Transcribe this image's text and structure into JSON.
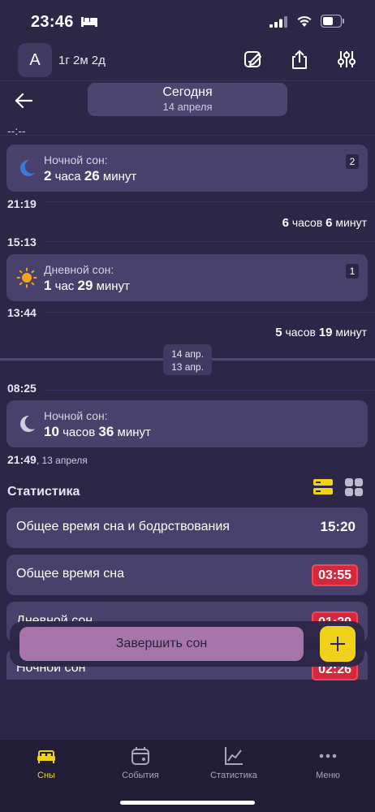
{
  "status_bar": {
    "time": "23:46"
  },
  "header": {
    "avatar_letter": "A",
    "age": "1г 2м 2д"
  },
  "date_nav": {
    "title": "Сегодня",
    "subtitle": "14 апреля"
  },
  "timeline": {
    "top_time": "--:--",
    "entries": [
      {
        "label": "Ночной сон:",
        "d1": "2",
        "u1": "часа",
        "d2": "26",
        "u2": "минут",
        "count": "2",
        "kind": "night"
      },
      {
        "label": "Дневной сон:",
        "d1": "1",
        "u1": "час",
        "d2": "29",
        "u2": "минут",
        "count": "1",
        "kind": "day"
      },
      {
        "label": "Ночной сон:",
        "d1": "10",
        "u1": "часов",
        "d2": "36",
        "u2": "минут",
        "kind": "night"
      }
    ],
    "times": [
      "21:19",
      "15:13",
      "13:44",
      "08:25",
      "21:49"
    ],
    "last_time_date": ", 13 апреля",
    "awake": [
      {
        "d1": "6",
        "u1": "часов",
        "d2": "6",
        "u2": "минут"
      },
      {
        "d1": "5",
        "u1": "часов",
        "d2": "19",
        "u2": "минут"
      }
    ],
    "day_badge": {
      "top": "14 апр.",
      "bottom": "13 апр."
    }
  },
  "stats": {
    "title": "Статистика",
    "rows": [
      {
        "label": "Общее время сна и бодрствования",
        "value": "15:20",
        "alert": false
      },
      {
        "label": "Общее время сна",
        "value": "03:55",
        "alert": true
      },
      {
        "label": "Дневной сон",
        "value": "01:29",
        "alert": true
      },
      {
        "label": "Ночной сон",
        "value": "02:26",
        "alert": true
      }
    ]
  },
  "actions": {
    "finish_sleep": "Завершить сон"
  },
  "bottom_nav": [
    {
      "label": "Сны",
      "icon": "bed-icon",
      "active": true
    },
    {
      "label": "События",
      "icon": "calendar-icon",
      "active": false
    },
    {
      "label": "Статистика",
      "icon": "chart-icon",
      "active": false
    },
    {
      "label": "Меню",
      "icon": "more-icon",
      "active": false
    }
  ],
  "colors": {
    "background": "#2c2747",
    "card": "#48416b",
    "accent": "#f0d21a",
    "alert": "#d6283c",
    "finish_button": "#a676ab"
  }
}
